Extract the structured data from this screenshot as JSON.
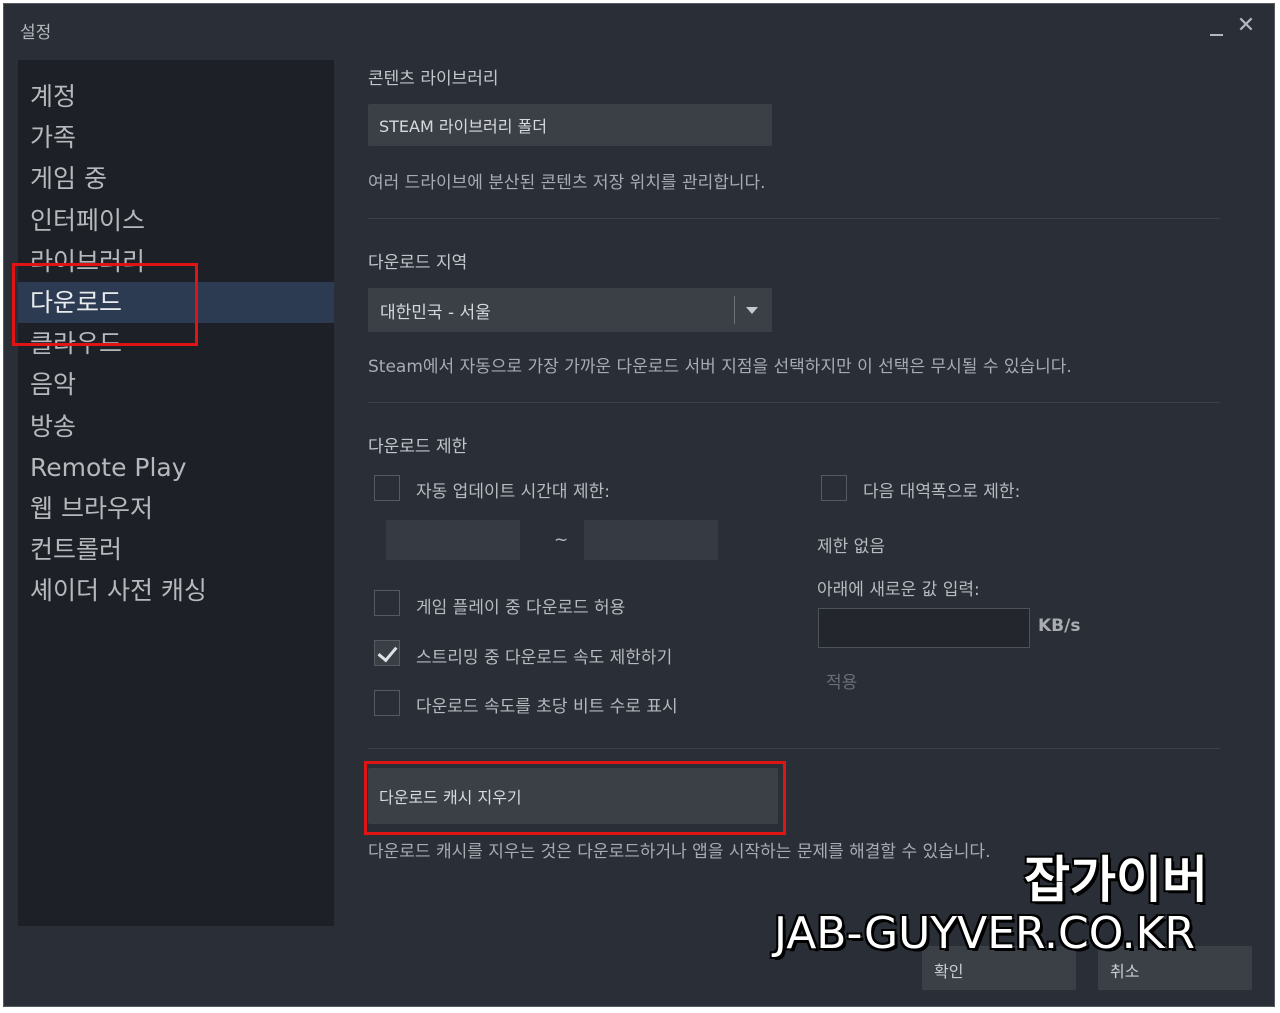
{
  "window": {
    "title": "설정"
  },
  "sidebar": {
    "items": [
      {
        "label": "계정"
      },
      {
        "label": "가족"
      },
      {
        "label": "게임 중"
      },
      {
        "label": "인터페이스"
      },
      {
        "label": "라이브러리"
      },
      {
        "label": "다운로드",
        "active": true
      },
      {
        "label": "클라우드"
      },
      {
        "label": "음악"
      },
      {
        "label": "방송"
      },
      {
        "label": "Remote Play"
      },
      {
        "label": "웹 브라우저"
      },
      {
        "label": "컨트롤러"
      },
      {
        "label": "셰이더 사전 캐싱"
      }
    ]
  },
  "content_library": {
    "title": "콘텐츠 라이브러리",
    "button": "STEAM 라이브러리 폴더",
    "desc": "여러 드라이브에 분산된 콘텐츠 저장 위치를 관리합니다."
  },
  "download_region": {
    "title": "다운로드 지역",
    "selected": "대한민국 - 서울",
    "desc": "Steam에서 자동으로 가장 가까운 다운로드 서버 지점을 선택하지만 이 선택은 무시될 수 있습니다."
  },
  "download_limits": {
    "title": "다운로드 제한",
    "auto_update_window": {
      "label": "자동 업데이트 시간대 제한:",
      "checked": false
    },
    "time_separator": "~",
    "allow_during_gameplay": {
      "label": "게임 플레이 중 다운로드 허용",
      "checked": false
    },
    "throttle_streaming": {
      "label": "스트리밍 중 다운로드 속도 제한하기",
      "checked": true
    },
    "show_bits": {
      "label": "다운로드 속도를 초당 비트 수로 표시",
      "checked": false
    },
    "bandwidth_limit": {
      "label": "다음 대역폭으로 제한:",
      "checked": false
    },
    "no_limit": "제한 없음",
    "enter_value": "아래에 새로운 값 입력:",
    "unit": "KB/s",
    "apply": "적용"
  },
  "cache": {
    "button": "다운로드 캐시 지우기",
    "desc": "다운로드 캐시를 지우는 것은 다운로드하거나 앱을 시작하는 문제를 해결할 수 있습니다."
  },
  "footer": {
    "ok": "확인",
    "cancel": "취소"
  },
  "watermark": {
    "name": "잡가이버",
    "url": "JAB-GUYVER.CO.KR"
  },
  "colors": {
    "background": "#2a2e36",
    "sidebar": "#1d2127",
    "active": "#2c3b52",
    "highlight": "#e01414"
  },
  "icons": {
    "minimize": "minimize-icon",
    "close": "close-icon",
    "dropdown": "chevron-down-icon",
    "check": "check-icon"
  }
}
